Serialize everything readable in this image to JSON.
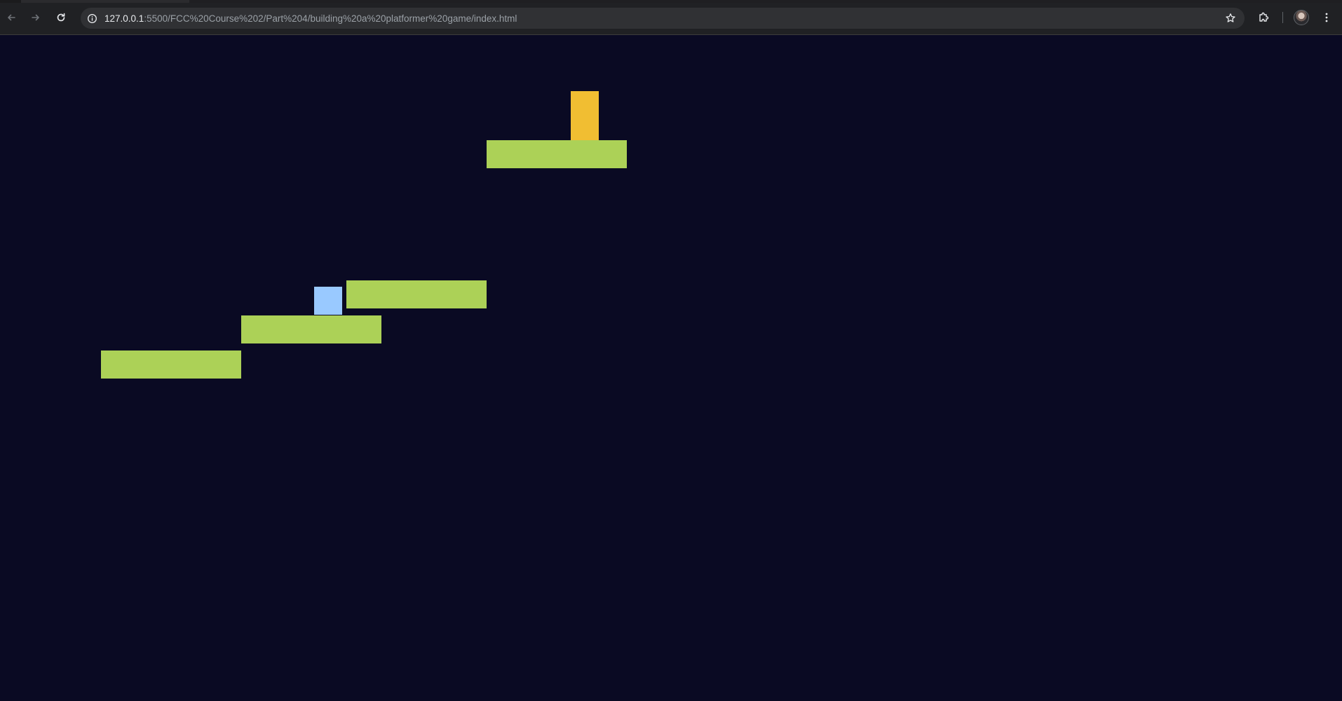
{
  "browser": {
    "url_host": "127.0.0.1",
    "url_rest": ":5500/FCC%20Course%202/Part%204/building%20a%20platformer%20game/index.html",
    "icons": {
      "back": "arrow-left-icon",
      "forward": "arrow-right-icon",
      "reload": "reload-icon",
      "site_info": "info-icon",
      "bookmark": "star-icon",
      "extensions": "puzzle-icon",
      "menu": "kebab-menu-icon"
    }
  },
  "game": {
    "colors": {
      "background": "#0a0a23",
      "platform": "#acd157",
      "player": "#99c9ff",
      "checkpoint": "#f1be32"
    },
    "platform_count": 4,
    "checkpoint_count": 1
  }
}
